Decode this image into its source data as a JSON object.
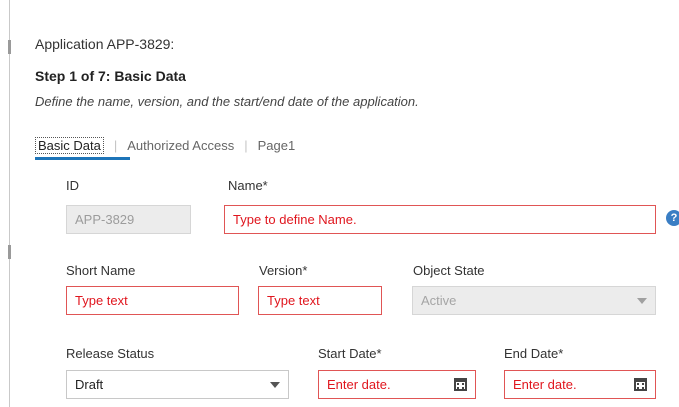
{
  "header": {
    "application_title": "Application APP-3829:",
    "step_title": "Step 1 of 7: Basic Data",
    "step_description": "Define the name, version, and the start/end date of the application."
  },
  "tabs": [
    {
      "label": "Basic Data",
      "active": true
    },
    {
      "label": "Authorized Access",
      "active": false
    },
    {
      "label": "Page1",
      "active": false
    }
  ],
  "form": {
    "id": {
      "label": "ID",
      "value": "APP-3829"
    },
    "name": {
      "label": "Name*",
      "placeholder": "Type to define Name."
    },
    "short_name": {
      "label": "Short Name",
      "placeholder": "Type text"
    },
    "version": {
      "label": "Version*",
      "placeholder": "Type text"
    },
    "object_state": {
      "label": "Object State",
      "value": "Active"
    },
    "release_status": {
      "label": "Release Status",
      "value": "Draft"
    },
    "start_date": {
      "label": "Start Date*",
      "placeholder": "Enter date."
    },
    "end_date": {
      "label": "End Date*",
      "placeholder": "Enter date."
    }
  },
  "icons": {
    "help": "help-icon",
    "calendar": "calendar-icon",
    "dropdown": "chevron-down-icon"
  },
  "colors": {
    "required": "#e0161e",
    "accent": "#1d74b8"
  }
}
